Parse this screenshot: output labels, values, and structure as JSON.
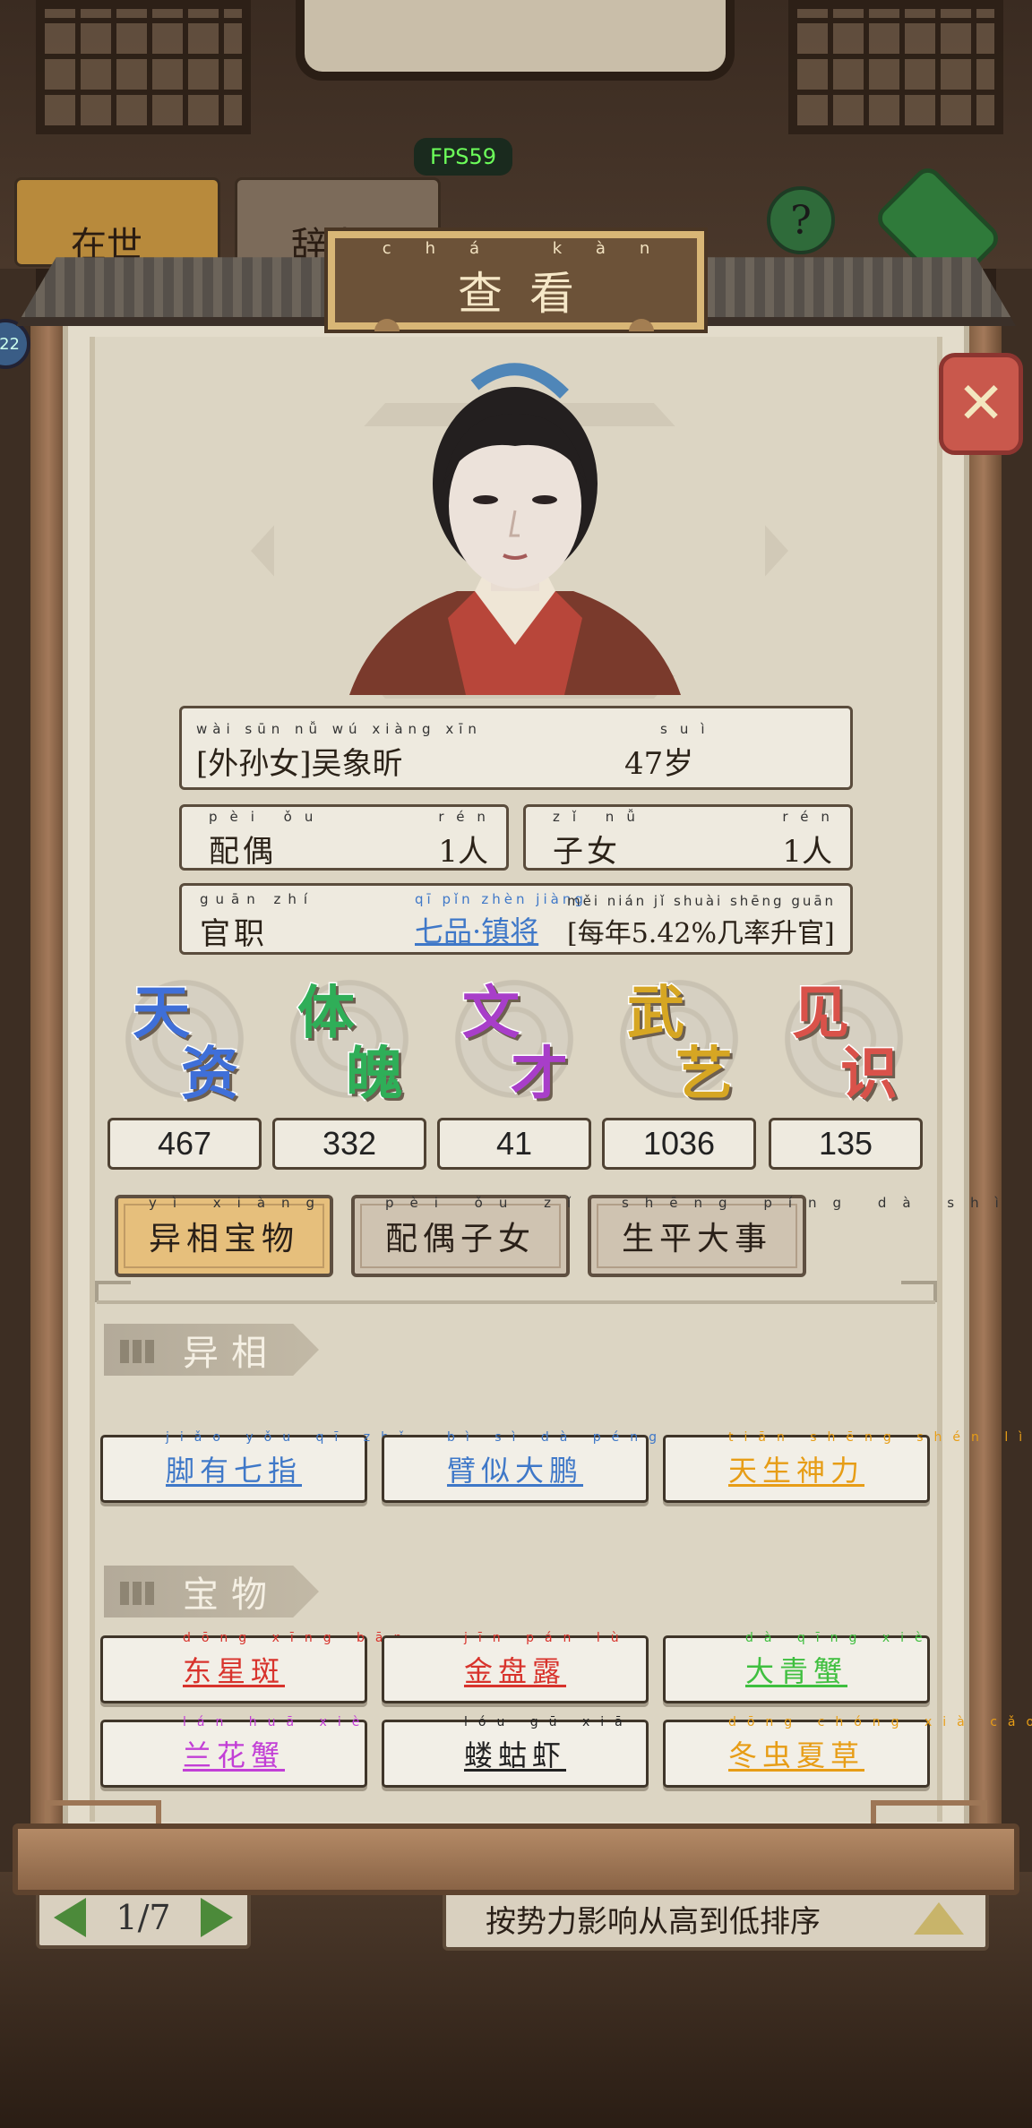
{
  "hud": {
    "fps": "FPS59",
    "badge": "22"
  },
  "background": {
    "tab_a": "在世",
    "tab_b": "辞世",
    "help_icon": "?",
    "pager_text": "1/7",
    "sort_text": "按势力影响从高到低排序"
  },
  "modal": {
    "title": "查看",
    "title_pinyin": "chá kàn",
    "close_icon": "close-icon"
  },
  "person": {
    "relation_name": "[外孙女]吴象昕",
    "relation_name_pinyin": "wài sūn nǚ   wú xiàng xīn",
    "age": "47岁",
    "age_pinyin": "suì",
    "spouse_label": "配偶",
    "spouse_label_pinyin": "pèi ǒu",
    "spouse_value": "1人",
    "spouse_value_pinyin": "rén",
    "children_label": "子女",
    "children_label_pinyin": "zǐ nǚ",
    "children_value": "1人",
    "children_value_pinyin": "rén",
    "office_label": "官职",
    "office_label_pinyin": "guān zhí",
    "office_value": "七品·镇将",
    "office_value_pinyin": "qī pǐn   zhèn jiàng",
    "promotion_text": "[每年5.42%几率升官]",
    "promotion_pinyin": "měi nián      jǐ shuài shēng guān"
  },
  "stats": [
    {
      "c1": "天",
      "c2": "资",
      "value": "467",
      "color": "#3f6fd8"
    },
    {
      "c1": "体",
      "c2": "魄",
      "value": "332",
      "color": "#2fae58"
    },
    {
      "c1": "文",
      "c2": "才",
      "value": "41",
      "color": "#a83ec9"
    },
    {
      "c1": "武",
      "c2": "艺",
      "value": "1036",
      "color": "#d6a623"
    },
    {
      "c1": "见",
      "c2": "识",
      "value": "135",
      "color": "#d9524a"
    }
  ],
  "tabs": [
    {
      "label": "异相宝物",
      "pinyin": "yì xiàng bǎo wù",
      "active": true
    },
    {
      "label": "配偶子女",
      "pinyin": "pèi ǒu zǐ nǚ",
      "active": false
    },
    {
      "label": "生平大事",
      "pinyin": "shēng píng dà shì",
      "active": false
    }
  ],
  "traits_section": {
    "title": "异相",
    "items": [
      {
        "label": "脚有七指",
        "pinyin": "jiǎo yǒu qī zhǐ",
        "color": "#3f78c8"
      },
      {
        "label": "臂似大鹏",
        "pinyin": "bì sì dà péng",
        "color": "#3f78c8"
      },
      {
        "label": "天生神力",
        "pinyin": "tiān shēng shén lì",
        "color": "#e79d16"
      }
    ]
  },
  "treasures_section": {
    "title": "宝物",
    "items": [
      {
        "label": "东星斑",
        "pinyin": "dōng xīng bān",
        "color": "#d8332c"
      },
      {
        "label": "金盘露",
        "pinyin": "jīn pán lù",
        "color": "#d8332c"
      },
      {
        "label": "大青蟹",
        "pinyin": "dà qīng xiè",
        "color": "#3fbf3f"
      },
      {
        "label": "兰花蟹",
        "pinyin": "lán huā xiè",
        "color": "#c23fd6"
      },
      {
        "label": "蝼蛄虾",
        "pinyin": "lóu gū xiā",
        "color": "#222222"
      },
      {
        "label": "冬虫夏草",
        "pinyin": "dōng chóng xià cǎo",
        "color": "#e79d16"
      }
    ]
  }
}
